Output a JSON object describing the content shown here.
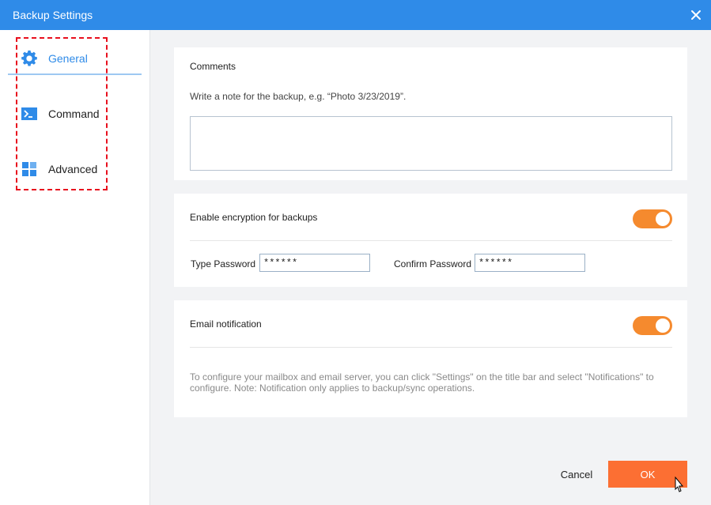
{
  "window": {
    "title": "Backup Settings"
  },
  "sidebar": {
    "items": [
      {
        "label": "General",
        "icon": "gear-icon",
        "active": true
      },
      {
        "label": "Command",
        "icon": "terminal-icon",
        "active": false
      },
      {
        "label": "Advanced",
        "icon": "grid-icon",
        "active": false
      }
    ]
  },
  "comments": {
    "heading": "Comments",
    "hint": "Write a note for the backup, e.g. “Photo 3/23/2019”.",
    "value": ""
  },
  "encryption": {
    "label": "Enable encryption for backups",
    "enabled": true,
    "type_password_label": "Type Password",
    "type_password_value": "******",
    "confirm_password_label": "Confirm Password",
    "confirm_password_value": "******"
  },
  "email": {
    "label": "Email notification",
    "enabled": true,
    "hint": "To configure your mailbox and email server, you can click \"Settings\" on the title bar and select \"Notifications\" to configure. Note: Notification only applies to backup/sync operations."
  },
  "footer": {
    "cancel_label": "Cancel",
    "ok_label": "OK"
  },
  "colors": {
    "accent": "#2f8be8",
    "toggle": "#f58a2e",
    "ok_button": "#fc6f33",
    "highlight": "#e8101e"
  }
}
